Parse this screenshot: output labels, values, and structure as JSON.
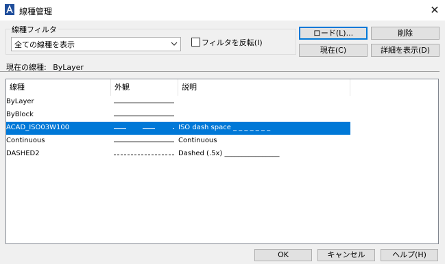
{
  "window": {
    "title": "線種管理",
    "close_symbol": "✕"
  },
  "filter": {
    "group_label": "線種フィルタ",
    "selected": "全ての線種を表示",
    "invert_label": "フィルタを反転(I)",
    "invert_checked": false
  },
  "buttons": {
    "load": "ロード(L)...",
    "delete": "削除",
    "current": "現在(C)",
    "details": "詳細を表示(D)",
    "ok": "OK",
    "cancel": "キャンセル",
    "help": "ヘルプ(H)"
  },
  "current_linetype": {
    "label": "現在の線種:",
    "value": "ByLayer"
  },
  "table": {
    "columns": [
      "線種",
      "外観",
      "説明"
    ],
    "rows": [
      {
        "name": "ByLayer",
        "appearance": "solid",
        "description": ""
      },
      {
        "name": "ByBlock",
        "appearance": "solid",
        "description": ""
      },
      {
        "name": "ACAD_ISO03W100",
        "appearance": "iso-dash-space",
        "description": "ISO dash space _ _ _ _ _ _ _",
        "selected": true
      },
      {
        "name": "Continuous",
        "appearance": "solid",
        "description": "Continuous"
      },
      {
        "name": "DASHED2",
        "appearance": "dashed",
        "description": "Dashed (.5x) ________________"
      }
    ]
  },
  "colors": {
    "selection": "#0078d7",
    "accent": "#0078d7"
  }
}
